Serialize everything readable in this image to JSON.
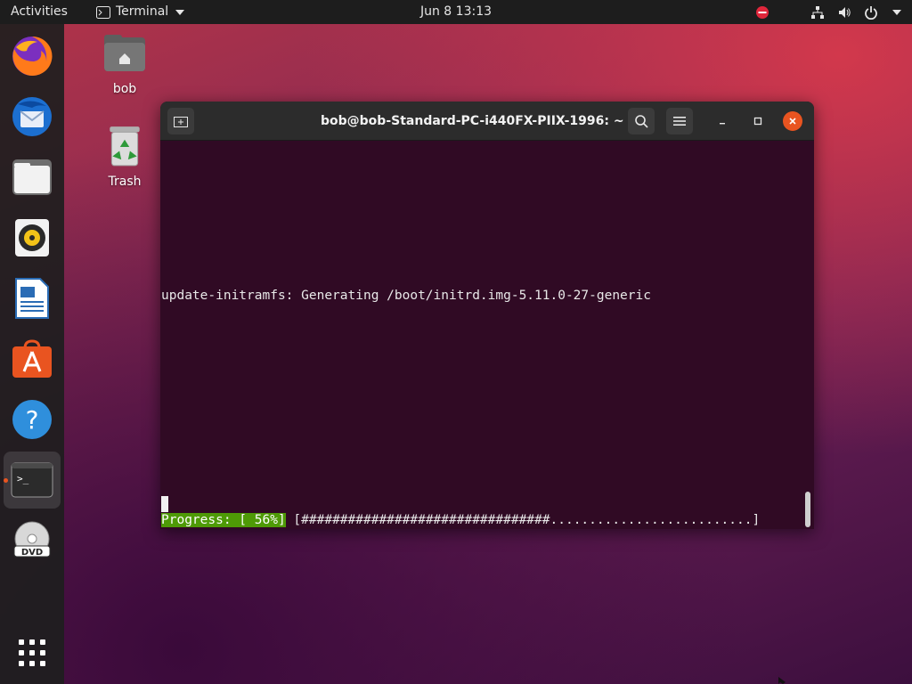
{
  "topbar": {
    "activities": "Activities",
    "app_name": "Terminal",
    "datetime": "Jun 8  13:13"
  },
  "dock": {
    "items": [
      {
        "name": "Firefox",
        "icon": "firefox-icon"
      },
      {
        "name": "Thunderbird",
        "icon": "thunderbird-icon"
      },
      {
        "name": "Files",
        "icon": "files-icon"
      },
      {
        "name": "Rhythmbox",
        "icon": "rhythmbox-icon"
      },
      {
        "name": "LibreOffice Writer",
        "icon": "writer-icon"
      },
      {
        "name": "Ubuntu Software",
        "icon": "software-icon"
      },
      {
        "name": "Help",
        "icon": "help-icon"
      },
      {
        "name": "Terminal",
        "icon": "terminal-icon"
      },
      {
        "name": "DVD",
        "icon": "dvd-icon"
      },
      {
        "name": "Show Applications",
        "icon": "app-grid-icon"
      }
    ]
  },
  "desktop": {
    "home_label": "bob",
    "trash_label": "Trash"
  },
  "terminal": {
    "title": "bob@bob-Standard-PC-i440FX-PIIX-1996: ~",
    "output_line": "update-initramfs: Generating /boot/initrd.img-5.11.0-27-generic",
    "progress_label": "Progress: [ 56%]",
    "progress_bar": " [################################..........................]",
    "progress_percent": 56
  },
  "colors": {
    "terminal_bg": "#300a24",
    "accent": "#e95420",
    "progress_green": "#4e9a06"
  }
}
